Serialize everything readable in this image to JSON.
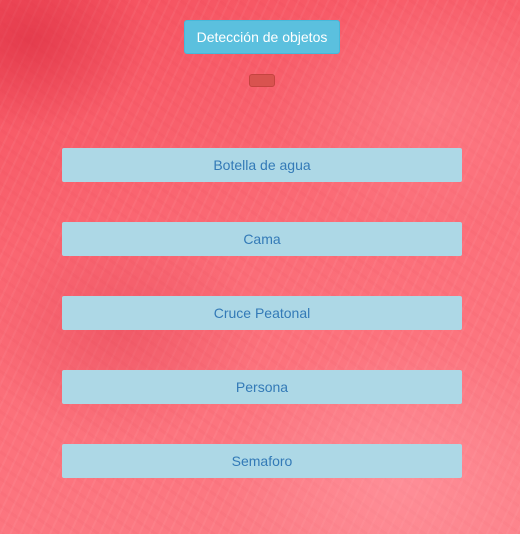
{
  "header": {
    "title_button_label": "Detección de objetos"
  },
  "objects": {
    "items": [
      {
        "label": "Botella de agua"
      },
      {
        "label": "Cama"
      },
      {
        "label": "Cruce Peatonal"
      },
      {
        "label": "Persona"
      },
      {
        "label": "Semaforo"
      }
    ]
  },
  "colors": {
    "background_base": "#fb6b76",
    "header_button": "#5bc0de",
    "indicator": "#d9534f",
    "item_background": "#add8e6",
    "item_text": "#337ab7"
  }
}
